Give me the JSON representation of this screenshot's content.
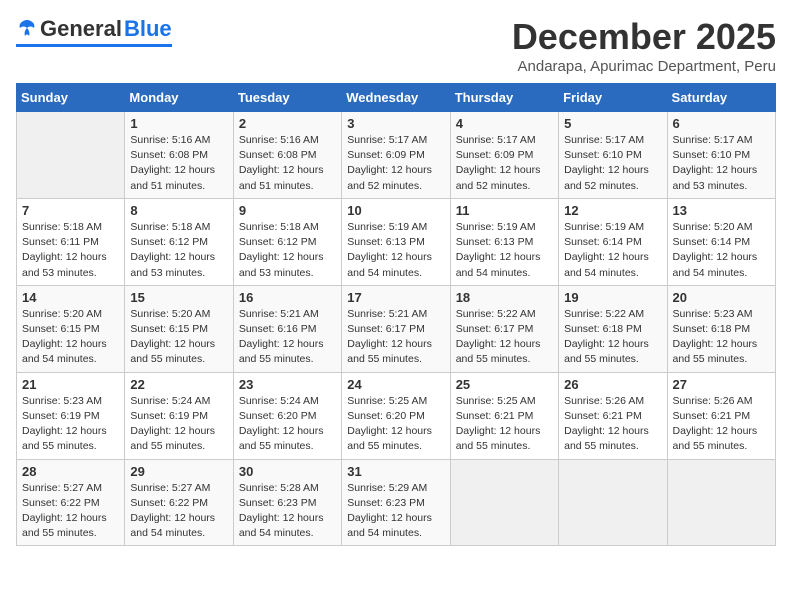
{
  "logo": {
    "general": "General",
    "blue": "Blue"
  },
  "header": {
    "month_year": "December 2025",
    "location": "Andarapa, Apurimac Department, Peru"
  },
  "weekdays": [
    "Sunday",
    "Monday",
    "Tuesday",
    "Wednesday",
    "Thursday",
    "Friday",
    "Saturday"
  ],
  "weeks": [
    [
      {
        "day": "",
        "info": ""
      },
      {
        "day": "1",
        "info": "Sunrise: 5:16 AM\nSunset: 6:08 PM\nDaylight: 12 hours\nand 51 minutes."
      },
      {
        "day": "2",
        "info": "Sunrise: 5:16 AM\nSunset: 6:08 PM\nDaylight: 12 hours\nand 51 minutes."
      },
      {
        "day": "3",
        "info": "Sunrise: 5:17 AM\nSunset: 6:09 PM\nDaylight: 12 hours\nand 52 minutes."
      },
      {
        "day": "4",
        "info": "Sunrise: 5:17 AM\nSunset: 6:09 PM\nDaylight: 12 hours\nand 52 minutes."
      },
      {
        "day": "5",
        "info": "Sunrise: 5:17 AM\nSunset: 6:10 PM\nDaylight: 12 hours\nand 52 minutes."
      },
      {
        "day": "6",
        "info": "Sunrise: 5:17 AM\nSunset: 6:10 PM\nDaylight: 12 hours\nand 53 minutes."
      }
    ],
    [
      {
        "day": "7",
        "info": "Sunrise: 5:18 AM\nSunset: 6:11 PM\nDaylight: 12 hours\nand 53 minutes."
      },
      {
        "day": "8",
        "info": "Sunrise: 5:18 AM\nSunset: 6:12 PM\nDaylight: 12 hours\nand 53 minutes."
      },
      {
        "day": "9",
        "info": "Sunrise: 5:18 AM\nSunset: 6:12 PM\nDaylight: 12 hours\nand 53 minutes."
      },
      {
        "day": "10",
        "info": "Sunrise: 5:19 AM\nSunset: 6:13 PM\nDaylight: 12 hours\nand 54 minutes."
      },
      {
        "day": "11",
        "info": "Sunrise: 5:19 AM\nSunset: 6:13 PM\nDaylight: 12 hours\nand 54 minutes."
      },
      {
        "day": "12",
        "info": "Sunrise: 5:19 AM\nSunset: 6:14 PM\nDaylight: 12 hours\nand 54 minutes."
      },
      {
        "day": "13",
        "info": "Sunrise: 5:20 AM\nSunset: 6:14 PM\nDaylight: 12 hours\nand 54 minutes."
      }
    ],
    [
      {
        "day": "14",
        "info": "Sunrise: 5:20 AM\nSunset: 6:15 PM\nDaylight: 12 hours\nand 54 minutes."
      },
      {
        "day": "15",
        "info": "Sunrise: 5:20 AM\nSunset: 6:15 PM\nDaylight: 12 hours\nand 55 minutes."
      },
      {
        "day": "16",
        "info": "Sunrise: 5:21 AM\nSunset: 6:16 PM\nDaylight: 12 hours\nand 55 minutes."
      },
      {
        "day": "17",
        "info": "Sunrise: 5:21 AM\nSunset: 6:17 PM\nDaylight: 12 hours\nand 55 minutes."
      },
      {
        "day": "18",
        "info": "Sunrise: 5:22 AM\nSunset: 6:17 PM\nDaylight: 12 hours\nand 55 minutes."
      },
      {
        "day": "19",
        "info": "Sunrise: 5:22 AM\nSunset: 6:18 PM\nDaylight: 12 hours\nand 55 minutes."
      },
      {
        "day": "20",
        "info": "Sunrise: 5:23 AM\nSunset: 6:18 PM\nDaylight: 12 hours\nand 55 minutes."
      }
    ],
    [
      {
        "day": "21",
        "info": "Sunrise: 5:23 AM\nSunset: 6:19 PM\nDaylight: 12 hours\nand 55 minutes."
      },
      {
        "day": "22",
        "info": "Sunrise: 5:24 AM\nSunset: 6:19 PM\nDaylight: 12 hours\nand 55 minutes."
      },
      {
        "day": "23",
        "info": "Sunrise: 5:24 AM\nSunset: 6:20 PM\nDaylight: 12 hours\nand 55 minutes."
      },
      {
        "day": "24",
        "info": "Sunrise: 5:25 AM\nSunset: 6:20 PM\nDaylight: 12 hours\nand 55 minutes."
      },
      {
        "day": "25",
        "info": "Sunrise: 5:25 AM\nSunset: 6:21 PM\nDaylight: 12 hours\nand 55 minutes."
      },
      {
        "day": "26",
        "info": "Sunrise: 5:26 AM\nSunset: 6:21 PM\nDaylight: 12 hours\nand 55 minutes."
      },
      {
        "day": "27",
        "info": "Sunrise: 5:26 AM\nSunset: 6:21 PM\nDaylight: 12 hours\nand 55 minutes."
      }
    ],
    [
      {
        "day": "28",
        "info": "Sunrise: 5:27 AM\nSunset: 6:22 PM\nDaylight: 12 hours\nand 55 minutes."
      },
      {
        "day": "29",
        "info": "Sunrise: 5:27 AM\nSunset: 6:22 PM\nDaylight: 12 hours\nand 54 minutes."
      },
      {
        "day": "30",
        "info": "Sunrise: 5:28 AM\nSunset: 6:23 PM\nDaylight: 12 hours\nand 54 minutes."
      },
      {
        "day": "31",
        "info": "Sunrise: 5:29 AM\nSunset: 6:23 PM\nDaylight: 12 hours\nand 54 minutes."
      },
      {
        "day": "",
        "info": ""
      },
      {
        "day": "",
        "info": ""
      },
      {
        "day": "",
        "info": ""
      }
    ]
  ]
}
